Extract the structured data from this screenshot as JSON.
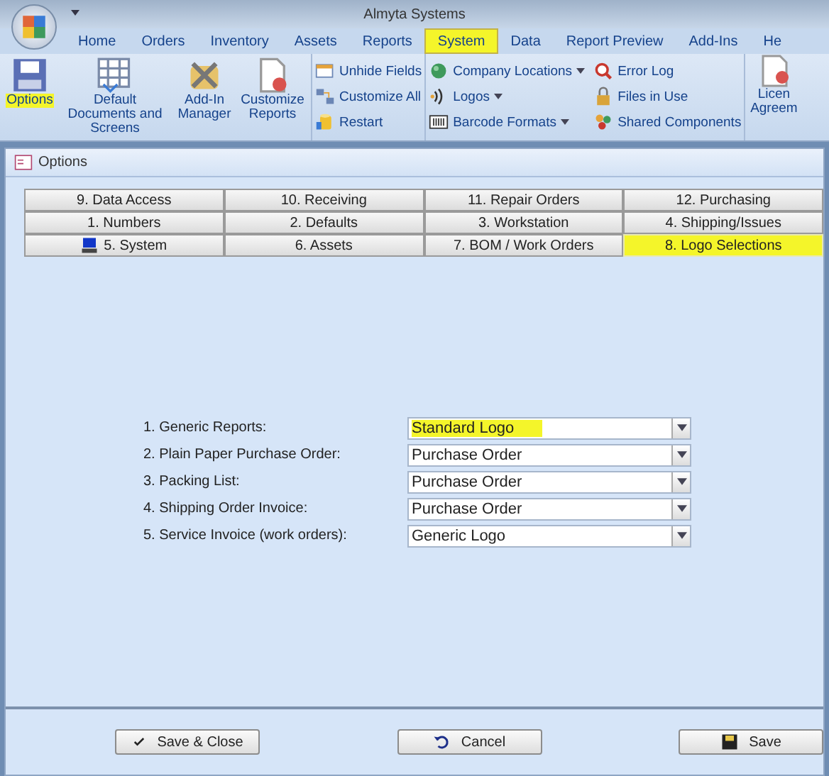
{
  "window": {
    "title": "Almyta Systems"
  },
  "ribbon_tabs": [
    {
      "label": "Home",
      "selected": false
    },
    {
      "label": "Orders",
      "selected": false
    },
    {
      "label": "Inventory",
      "selected": false
    },
    {
      "label": "Assets",
      "selected": false
    },
    {
      "label": "Reports",
      "selected": false
    },
    {
      "label": "System",
      "selected": true
    },
    {
      "label": "Data",
      "selected": false
    },
    {
      "label": "Report Preview",
      "selected": false
    },
    {
      "label": "Add-Ins",
      "selected": false
    },
    {
      "label": "He",
      "selected": false
    }
  ],
  "ribbon_large": [
    {
      "label": "Options",
      "highlighted": true
    },
    {
      "label": "Default Documents and Screens",
      "highlighted": false
    },
    {
      "label": "Add-In Manager",
      "highlighted": false
    },
    {
      "label": "Customize Reports",
      "highlighted": false
    }
  ],
  "ribbon_small": [
    {
      "label": "Unhide Fields",
      "dropdown": false
    },
    {
      "label": "Customize All",
      "dropdown": false
    },
    {
      "label": "Restart",
      "dropdown": false
    }
  ],
  "ribbon_small_2": [
    {
      "label": "Company Locations",
      "dropdown": true
    },
    {
      "label": "Logos",
      "dropdown": true
    },
    {
      "label": "Barcode Formats",
      "dropdown": true
    }
  ],
  "ribbon_small_3": [
    {
      "label": "Error Log",
      "dropdown": false
    },
    {
      "label": "Files in Use",
      "dropdown": false
    },
    {
      "label": "Shared Components",
      "dropdown": false
    }
  ],
  "ribbon_cut": {
    "label": "Licen Agreem"
  },
  "dialog": {
    "title": "Options"
  },
  "tab_rows": [
    [
      {
        "label": "9. Data Access",
        "selected": false
      },
      {
        "label": "10. Receiving",
        "selected": false
      },
      {
        "label": "11. Repair Orders",
        "selected": false
      },
      {
        "label": "12. Purchasing",
        "selected": false
      }
    ],
    [
      {
        "label": "1. Numbers",
        "selected": false
      },
      {
        "label": "2. Defaults",
        "selected": false
      },
      {
        "label": "3. Workstation",
        "selected": false
      },
      {
        "label": "4. Shipping/Issues",
        "selected": false
      }
    ],
    [
      {
        "label": "5. System",
        "selected": false,
        "icon": true
      },
      {
        "label": "6. Assets",
        "selected": false
      },
      {
        "label": "7. BOM / Work Orders",
        "selected": false
      },
      {
        "label": "8. Logo Selections",
        "selected": true
      }
    ]
  ],
  "fields": [
    {
      "label": "1. Generic  Reports:",
      "value": "Standard Logo",
      "highlighted": true
    },
    {
      "label": "2. Plain Paper Purchase Order:",
      "value": "Purchase Order",
      "highlighted": false
    },
    {
      "label": "3. Packing List:",
      "value": "Purchase Order",
      "highlighted": false
    },
    {
      "label": "4. Shipping Order Invoice:",
      "value": "Purchase Order",
      "highlighted": false
    },
    {
      "label": "5. Service Invoice (work orders):",
      "value": "Generic Logo",
      "highlighted": false
    }
  ],
  "buttons": [
    {
      "label": "Save & Close",
      "kind": "check"
    },
    {
      "label": "Cancel",
      "kind": "undo"
    },
    {
      "label": "Save",
      "kind": "save"
    }
  ]
}
